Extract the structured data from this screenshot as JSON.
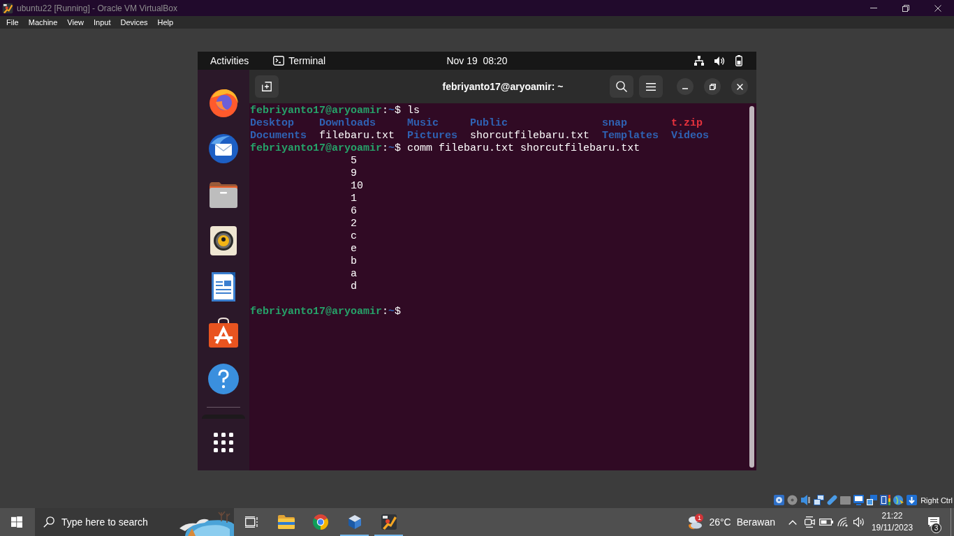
{
  "window": {
    "title": "ubuntu22 [Running] - Oracle VM VirtualBox"
  },
  "menu_bar": {
    "items": [
      "File",
      "Machine",
      "View",
      "Input",
      "Devices",
      "Help"
    ]
  },
  "guest": {
    "top_bar": {
      "activities": "Activities",
      "app_menu": "Terminal",
      "clock": "Nov 19  08:20"
    },
    "terminal": {
      "title": "febriyanto17@aryoamir: ~",
      "lines": [
        {
          "kind": "prompt",
          "user_host": "febriyanto17@aryoamir",
          "separator": ":",
          "path": "~",
          "symbol": "$",
          "command": "ls"
        },
        {
          "kind": "listing",
          "entries": [
            {
              "name": "Desktop",
              "kind": "directory"
            },
            {
              "name": "Downloads",
              "kind": "directory"
            },
            {
              "name": "Music",
              "kind": "directory"
            },
            {
              "name": "Public",
              "kind": "directory"
            },
            {
              "name": "snap",
              "kind": "directory"
            },
            {
              "name": "t.zip",
              "kind": "archive"
            }
          ]
        },
        {
          "kind": "listing",
          "entries": [
            {
              "name": "Documents",
              "kind": "directory"
            },
            {
              "name": "filebaru.txt",
              "kind": "file"
            },
            {
              "name": "Pictures",
              "kind": "directory"
            },
            {
              "name": "shorcutfilebaru.txt",
              "kind": "file"
            },
            {
              "name": "Templates",
              "kind": "directory"
            },
            {
              "name": "Videos",
              "kind": "directory"
            }
          ]
        },
        {
          "kind": "prompt",
          "user_host": "febriyanto17@aryoamir",
          "separator": ":",
          "path": "~",
          "symbol": "$",
          "command": "comm filebaru.txt shorcutfilebaru.txt"
        },
        {
          "kind": "common",
          "text": "5"
        },
        {
          "kind": "common",
          "text": "9"
        },
        {
          "kind": "common",
          "text": "10"
        },
        {
          "kind": "common",
          "text": "1"
        },
        {
          "kind": "common",
          "text": "6"
        },
        {
          "kind": "common",
          "text": "2"
        },
        {
          "kind": "common",
          "text": "c"
        },
        {
          "kind": "common",
          "text": "e"
        },
        {
          "kind": "common",
          "text": "b"
        },
        {
          "kind": "common",
          "text": "a"
        },
        {
          "kind": "common",
          "text": "d"
        },
        {
          "kind": "blank"
        },
        {
          "kind": "prompt",
          "user_host": "febriyanto17@aryoamir",
          "separator": ":",
          "path": "~",
          "symbol": "$"
        }
      ]
    }
  },
  "vm_status_bar": {
    "host_key": "Right Ctrl"
  },
  "taskbar": {
    "search": {
      "placeholder": "Type here to search"
    },
    "apps": [
      {
        "kind": "folder",
        "running": false
      },
      {
        "kind": "browser",
        "running": false
      },
      {
        "kind": "cube",
        "running": true
      },
      {
        "kind": "vm",
        "running": true
      }
    ],
    "weather": {
      "badge": "1",
      "temperature": "26°C",
      "condition": "Berawan"
    },
    "clock": {
      "time": "21:22",
      "date": "19/11/2023"
    },
    "notifications": {
      "badge": "3"
    }
  }
}
